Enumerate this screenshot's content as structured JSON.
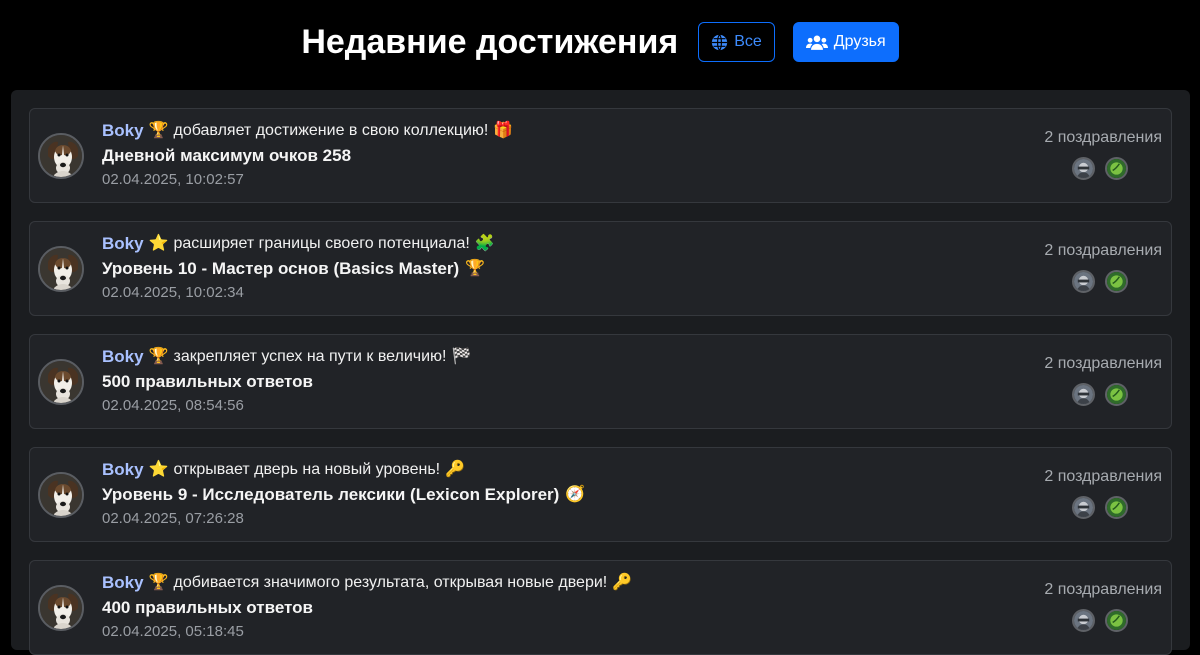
{
  "header": {
    "title": "Недавние достижения",
    "filter_all": "Все",
    "filter_friends": "Друзья"
  },
  "colors": {
    "accent": "#0d6efd",
    "background": "#000000",
    "panel": "#1b1d20",
    "card": "#212327",
    "username": "#a9c1ff"
  },
  "feed": [
    {
      "user": "Boky",
      "badge_icon": "trophy-icon",
      "action": "добавляет достижение в свою коллекцию!",
      "action_icon": "gift-icon",
      "achievement": "Дневной максимум очков 258",
      "achievement_icon": "",
      "timestamp": "02.04.2025, 10:02:57",
      "congrats": "2 поздравления"
    },
    {
      "user": "Boky",
      "badge_icon": "star-icon",
      "action": "расширяет границы своего потенциала!",
      "action_icon": "puzzle-icon",
      "achievement": "Уровень 10 - Мастер основ (Basics Master)",
      "achievement_icon": "trophy-icon",
      "timestamp": "02.04.2025, 10:02:34",
      "congrats": "2 поздравления"
    },
    {
      "user": "Boky",
      "badge_icon": "trophy-icon",
      "action": "закрепляет успех на пути к величию!",
      "action_icon": "checkered-flag-icon",
      "achievement": "500 правильных ответов",
      "achievement_icon": "",
      "timestamp": "02.04.2025, 08:54:56",
      "congrats": "2 поздравления"
    },
    {
      "user": "Boky",
      "badge_icon": "star-icon",
      "action": "открывает дверь на новый уровень!",
      "action_icon": "key-icon",
      "achievement": "Уровень 9 - Исследователь лексики (Lexicon Explorer)",
      "achievement_icon": "compass-icon",
      "timestamp": "02.04.2025, 07:26:28",
      "congrats": "2 поздравления"
    },
    {
      "user": "Boky",
      "badge_icon": "trophy-icon",
      "action": "добивается значимого результата, открывая новые двери!",
      "action_icon": "key-icon",
      "achievement": "400 правильных ответов",
      "achievement_icon": "",
      "timestamp": "02.04.2025, 05:18:45",
      "congrats": "2 поздравления"
    }
  ]
}
